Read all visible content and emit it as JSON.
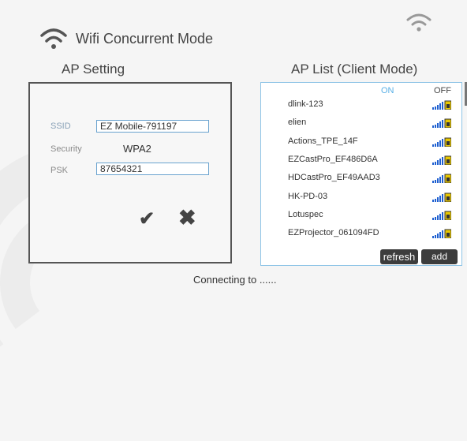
{
  "header": {
    "title": "Wifi Concurrent Mode"
  },
  "ap_setting": {
    "label": "AP Setting",
    "ssid_label": "SSID",
    "ssid_value": "EZ Mobile-791197",
    "security_label": "Security",
    "security_value": "WPA2",
    "psk_label": "PSK",
    "psk_value": "87654321"
  },
  "ap_list": {
    "label": "AP List (Client Mode)",
    "toggle_on": "ON",
    "toggle_off": "OFF",
    "items": [
      "dlink-123",
      "elien",
      "Actions_TPE_14F",
      "EZCastPro_EF486D6A",
      "HDCastPro_EF49AAD3",
      "HK-PD-03",
      "Lotuspec",
      "EZProjector_061094FD"
    ],
    "refresh_label": "refresh",
    "add_label": "add"
  },
  "status": "Connecting to ......",
  "colors": {
    "accent": "#5ab0e6",
    "signal": "#1e5fd0",
    "lock": "#e8c700"
  },
  "icons": [
    "wifi-icon",
    "signal-lock-icon",
    "check-icon",
    "close-icon"
  ]
}
